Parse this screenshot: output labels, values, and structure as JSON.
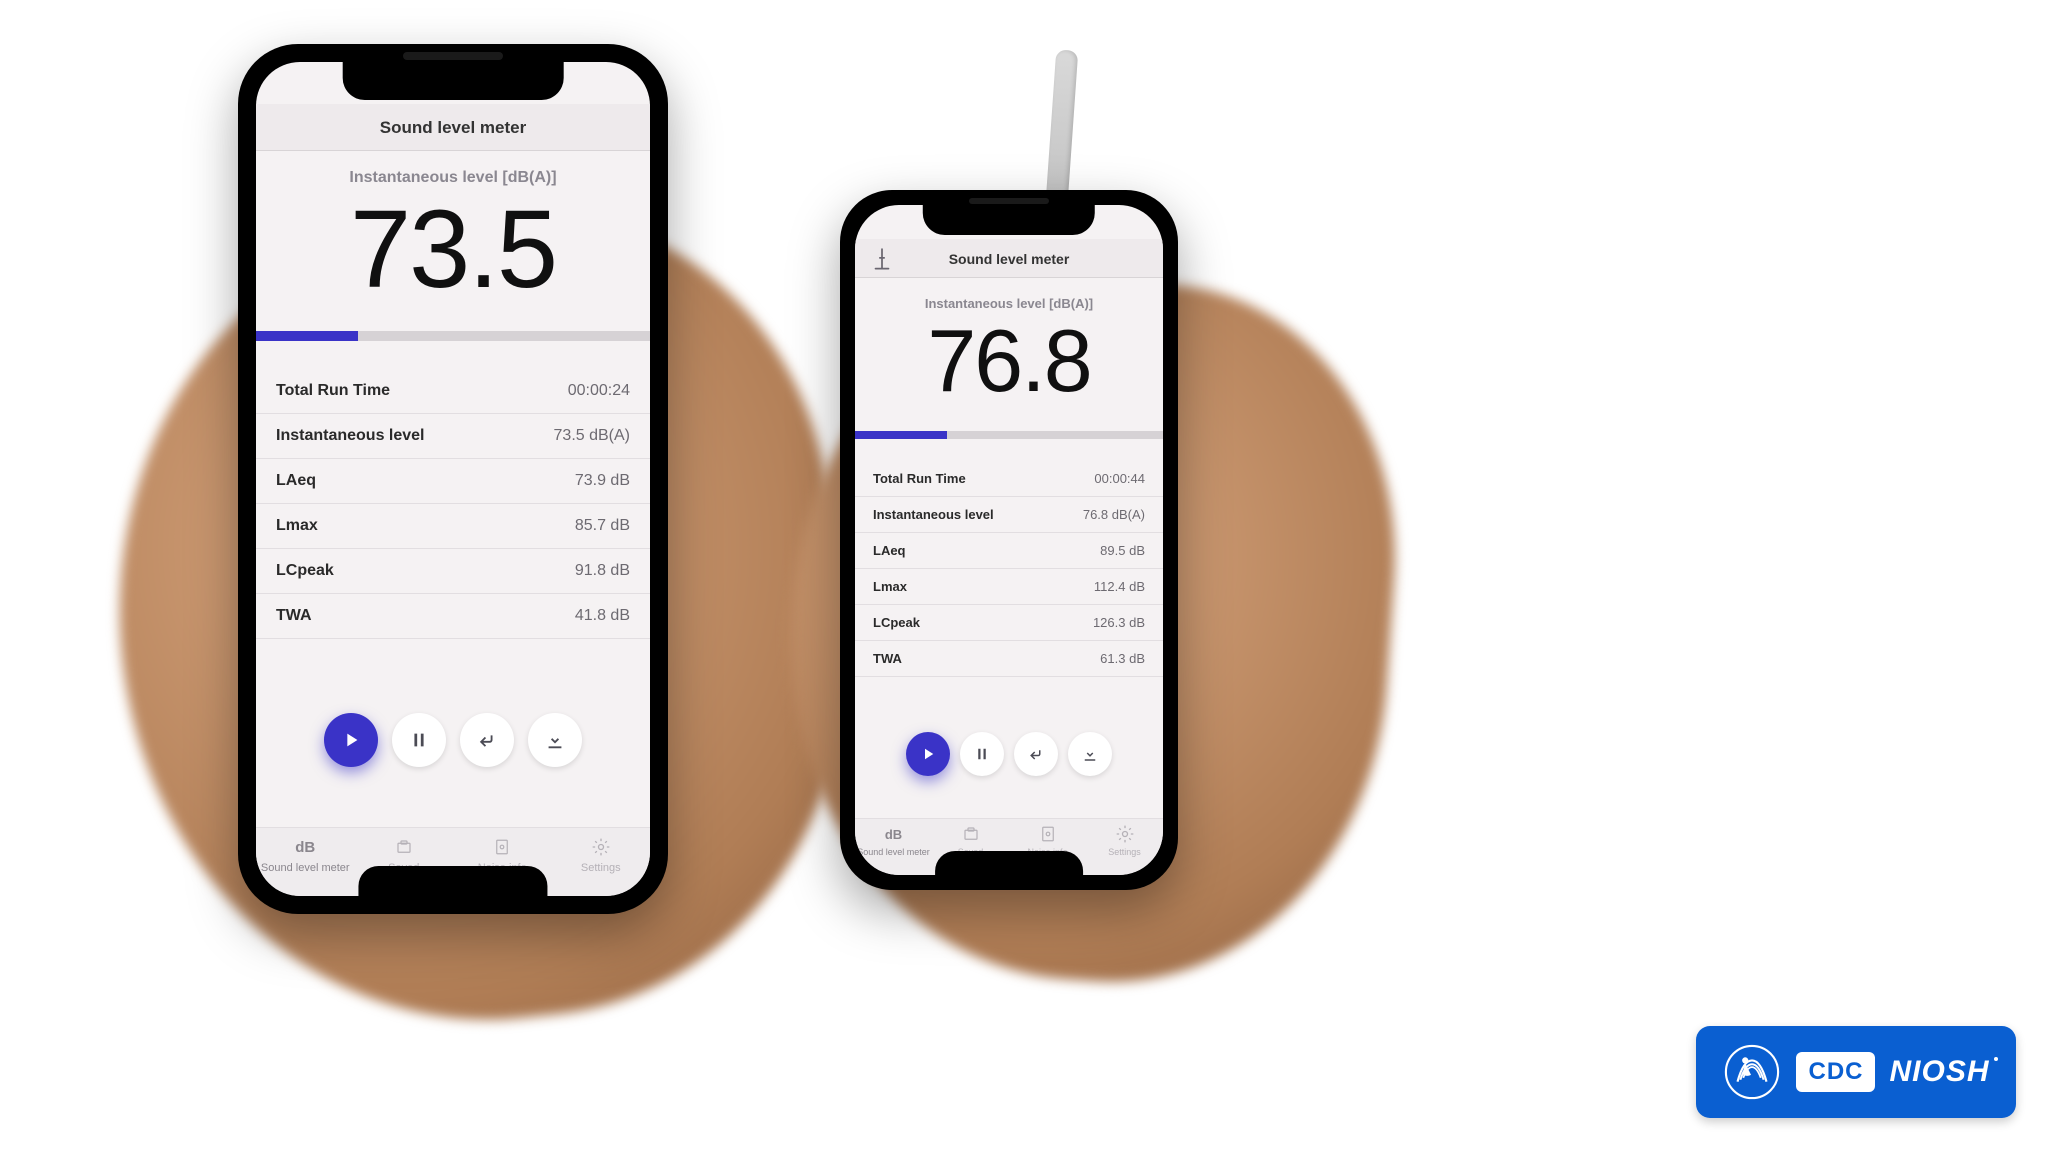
{
  "phones": {
    "left": {
      "title": "Sound level meter",
      "reading_label": "Instantaneous level [dB(A)]",
      "reading_value": "73.5",
      "level_percent": 26,
      "metrics": [
        {
          "name": "Total Run Time",
          "value": "00:00:24"
        },
        {
          "name": "Instantaneous level",
          "value": "73.5 dB(A)"
        },
        {
          "name": "LAeq",
          "value": "73.9 dB"
        },
        {
          "name": "Lmax",
          "value": "85.7 dB"
        },
        {
          "name": "LCpeak",
          "value": "91.8 dB"
        },
        {
          "name": "TWA",
          "value": "41.8 dB"
        }
      ],
      "has_mic_icon": false
    },
    "right": {
      "title": "Sound level meter",
      "reading_label": "Instantaneous level [dB(A)]",
      "reading_value": "76.8",
      "level_percent": 30,
      "metrics": [
        {
          "name": "Total Run Time",
          "value": "00:00:44"
        },
        {
          "name": "Instantaneous level",
          "value": "76.8 dB(A)"
        },
        {
          "name": "LAeq",
          "value": "89.5 dB"
        },
        {
          "name": "Lmax",
          "value": "112.4 dB"
        },
        {
          "name": "LCpeak",
          "value": "126.3 dB"
        },
        {
          "name": "TWA",
          "value": "61.3 dB"
        }
      ],
      "has_mic_icon": true
    }
  },
  "controls": {
    "play": "play",
    "pause": "pause",
    "reset": "reset",
    "save": "save"
  },
  "tabs": [
    {
      "icon": "dB",
      "label": "Sound level meter"
    },
    {
      "icon": "box",
      "label": "Saved"
    },
    {
      "icon": "doc",
      "label": "Noise info"
    },
    {
      "icon": "gear",
      "label": "Settings"
    }
  ],
  "badge": {
    "cdc": "CDC",
    "niosh": "NIOSH"
  }
}
